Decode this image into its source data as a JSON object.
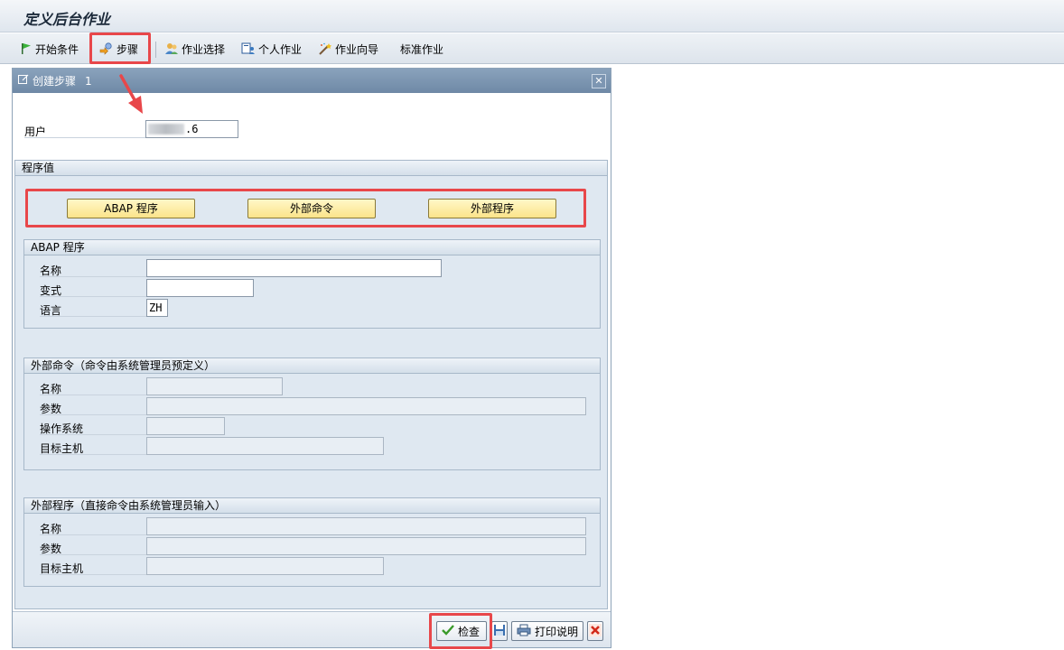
{
  "window": {
    "title": "定义后台作业"
  },
  "toolbar": {
    "items": [
      {
        "label": "开始条件",
        "icon": "flag-icon"
      },
      {
        "label": "步骤",
        "icon": "step-icon"
      },
      {
        "label": "作业选择",
        "icon": "job-selection-icon"
      },
      {
        "label": "个人作业",
        "icon": "own-jobs-icon"
      },
      {
        "label": "作业向导",
        "icon": "wizard-icon"
      },
      {
        "label": "标准作业",
        "icon": ""
      }
    ]
  },
  "dialog": {
    "title": "创建步骤",
    "number": "1",
    "user": {
      "label": "用户",
      "value": ".6"
    },
    "program_values": {
      "title": "程序值",
      "buttons": [
        "ABAP 程序",
        "外部命令",
        "外部程序"
      ]
    },
    "abap_group": {
      "title": "ABAP 程序",
      "fields": [
        {
          "label": "名称",
          "value": ""
        },
        {
          "label": "变式",
          "value": ""
        },
        {
          "label": "语言",
          "value": "ZH"
        }
      ]
    },
    "ext_cmd_group": {
      "title": "外部命令（命令由系统管理员预定义）",
      "fields": [
        {
          "label": "名称",
          "value": ""
        },
        {
          "label": "参数",
          "value": ""
        },
        {
          "label": "操作系统",
          "value": ""
        },
        {
          "label": "目标主机",
          "value": ""
        }
      ]
    },
    "ext_prog_group": {
      "title": "外部程序（直接命令由系统管理员输入）",
      "fields": [
        {
          "label": "名称",
          "value": ""
        },
        {
          "label": "参数",
          "value": ""
        },
        {
          "label": "目标主机",
          "value": ""
        }
      ]
    },
    "footer": {
      "check_label": "检查",
      "print_label": "打印说明"
    }
  },
  "colors": {
    "highlight": "#e8474a",
    "dialog_header": "#7b93ae",
    "yellow_button": "#fbe48a"
  }
}
